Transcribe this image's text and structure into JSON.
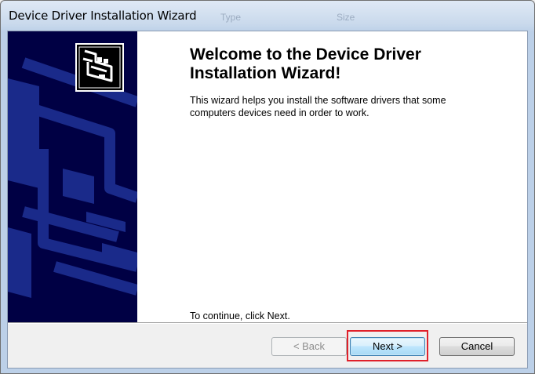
{
  "window": {
    "title": "Device Driver Installation Wizard",
    "ghost_columns": [
      "Type",
      "Size"
    ]
  },
  "content": {
    "heading": "Welcome to the Device Driver Installation Wizard!",
    "description": "This wizard helps you install the software drivers that some computers devices need in order to work.",
    "continue_text": "To continue, click Next."
  },
  "buttons": {
    "back_label": "< Back",
    "back_enabled": false,
    "next_label": "Next >",
    "cancel_label": "Cancel"
  },
  "colors": {
    "banner": "#000044",
    "banner_art": "#1a2a8a",
    "highlight": "#e0202a"
  },
  "icons": [
    "wizard-logo-icon"
  ]
}
